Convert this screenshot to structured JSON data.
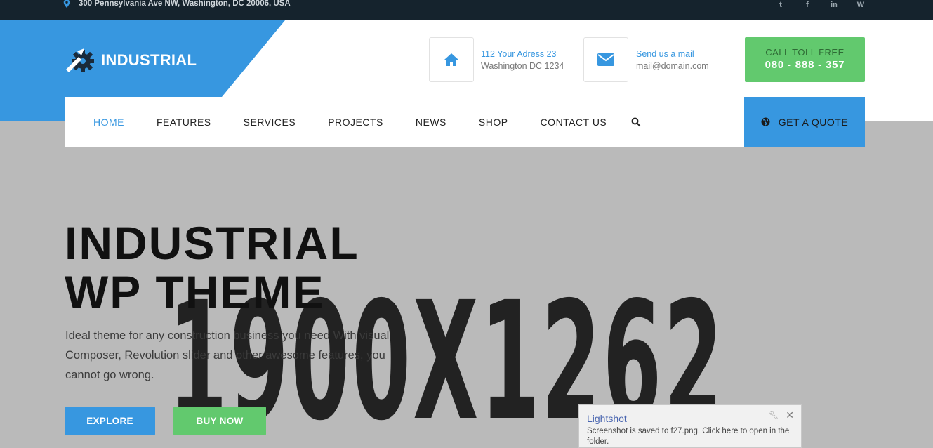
{
  "topbar": {
    "address": "300 Pennsylvania Ave NW, Washington, DC 20006, USA",
    "social": [
      {
        "icon": "twitter-icon",
        "glyph": "t"
      },
      {
        "icon": "facebook-icon",
        "glyph": "f"
      },
      {
        "icon": "linkedin-icon",
        "glyph": "in"
      },
      {
        "icon": "wordpress-icon",
        "glyph": "W"
      }
    ]
  },
  "brand": {
    "name": "INDUSTRIAL",
    "color": "#3797e0"
  },
  "contact": {
    "address_line1": "112 Your Adress 23",
    "address_line2": "Washington DC 1234",
    "mail_line1": "Send us a mail",
    "mail_line2": "mail@domain.com",
    "call_label": "CALL TOLL FREE",
    "call_number": "080 - 888 - 357"
  },
  "nav": {
    "items": [
      "HOME",
      "FEATURES",
      "SERVICES",
      "PROJECTS",
      "NEWS",
      "SHOP",
      "CONTACT US"
    ],
    "active": "HOME",
    "quote_label": "GET A QUOTE"
  },
  "hero": {
    "title_line1": "INDUSTRIAL",
    "title_line2": "WP THEME",
    "subtitle": "Ideal theme for any construction business you need With visual Composer, Revolution slider and other awesome features, you cannot go wrong.",
    "placeholder": "1900X1262",
    "explore_label": "EXPLORE",
    "buy_label": "BUY NOW"
  },
  "toast": {
    "title": "Lightshot",
    "message": "Screenshot is saved to f27.png. Click here to open in the folder.",
    "close": "✕"
  },
  "colors": {
    "accent": "#3797e0",
    "green": "#62c96e",
    "topbar": "#15232d"
  }
}
